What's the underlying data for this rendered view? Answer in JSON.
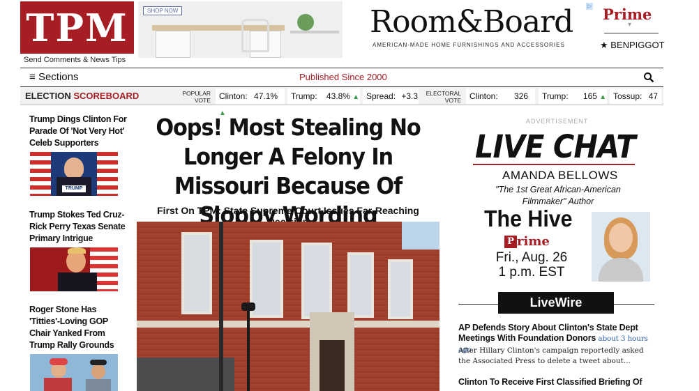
{
  "header": {
    "logo": "TPM",
    "send_link": "Send Comments & News Tips",
    "ad1": {
      "cta": "SHOP NOW"
    },
    "ad2": {
      "brand": "Room&Board",
      "tagline": "AMERICAN-MADE HOME FURNISHINGS AND ACCESSORIES",
      "adchoice": "▷"
    },
    "prime": {
      "label": "Prime",
      "chevron": "▾"
    },
    "user": {
      "star": "★",
      "name": "BENPIGGOT"
    }
  },
  "nav": {
    "sections_icon": "≡",
    "sections_label": "Sections",
    "published": "Published Since 2000",
    "search_icon": "search-icon"
  },
  "scoreboard": {
    "title_a": "ELECTION",
    "title_b": "SCOREBOARD",
    "popular_label": "POPULAR\nVOTE",
    "electoral_label": "ELECTORAL\nVOTE",
    "clinton_label": "Clinton:",
    "clinton_pct": "47.1%",
    "trump_label": "Trump:",
    "trump_pct": "43.8%",
    "spread_label": "Spread:",
    "spread_val": "+3.3",
    "e_clinton_label": "Clinton:",
    "e_clinton_val": "326",
    "e_trump_label": "Trump:",
    "e_trump_val": "165",
    "tossup_label": "Tossup:",
    "tossup_val": "47",
    "arrow_up": "▲",
    "accent": "#a61d24",
    "up_color": "#3a9a4a"
  },
  "sidebar": {
    "stories": [
      {
        "headline": "Trump Dings Clinton For Parade Of 'Not Very Hot' Celeb Supporters",
        "thumb_text": "TRUMP"
      },
      {
        "headline": "Trump Stokes Ted Cruz-Rick Perry Texas Senate Primary Intrigue"
      },
      {
        "headline": "Roger Stone Has 'Titties'-Loving GOP Chair Yanked From Trump Rally Grounds"
      }
    ]
  },
  "main": {
    "headline": "Oops! Most Stealing No Longer A Felony In Missouri Because Of Sloppy Wording",
    "subhead": "First On TPM: State Supreme Court Issues Far-Reaching Decision"
  },
  "right": {
    "ad_label": "ADVERTISEMENT",
    "live_chat": "LIVE CHAT",
    "author": "AMANDA BELLOWS",
    "quote": "\"The 1st Great African-American Filmmaker\" Author",
    "hive": "The Hive",
    "prime": "Prime",
    "date_line1": "Fri., Aug. 26",
    "date_line2": "1 p.m. EST",
    "livewire": "LiveWire",
    "lw_items": [
      {
        "headline": "AP Defends Story About Clinton's State Dept Meetings With Foundation Donors",
        "ago": "about 3 hours ago",
        "blurb": "After Hillary Clinton's campaign reportedly asked the Associated Press to delete a tweet about..."
      },
      {
        "headline": "Clinton To Receive First Classified Briefing Of"
      }
    ]
  }
}
